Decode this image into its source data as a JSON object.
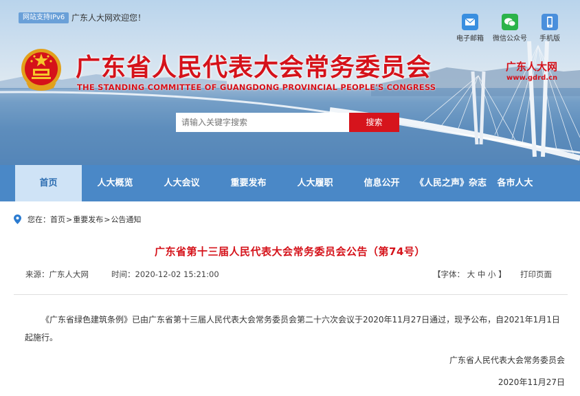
{
  "header": {
    "ipv6_badge": "网站支持IPv6",
    "welcome": "广东人大网欢迎您！",
    "quick_links": [
      {
        "label": "电子邮箱",
        "icon": "mail-icon",
        "color": "#3a8fe0"
      },
      {
        "label": "微信公众号",
        "icon": "wechat-icon",
        "color": "#2bb34a"
      },
      {
        "label": "手机版",
        "icon": "mobile-icon",
        "color": "#4a8fdc"
      }
    ],
    "title": "广东省人民代表大会常务委员会",
    "subtitle": "THE STANDING COMMITTEE OF GUANGDONG PROVINCIAL PEOPLE'S CONGRESS",
    "brand_name": "广东人大网",
    "brand_url": "www.gdrd.cn",
    "search": {
      "placeholder": "请输入关键字搜索",
      "button": "搜索"
    }
  },
  "nav": {
    "items": [
      "首页",
      "人大概览",
      "人大会议",
      "重要发布",
      "人大履职",
      "信息公开",
      "《人民之声》杂志",
      "各市人大"
    ],
    "active_index": 0
  },
  "breadcrumb": {
    "prefix": "您在：",
    "items": [
      "首页",
      "重要发布",
      "公告通知"
    ],
    "separator": ">"
  },
  "article": {
    "title": "广东省第十三届人民代表大会常务委员会公告（第74号）",
    "source": "来源：广东人大网",
    "time": "时间：2020-12-02 15:21:00",
    "font_label": "【字体：",
    "font_sizes": [
      "大",
      "中",
      "小"
    ],
    "font_close": "】",
    "print": "打印页面",
    "body": "《广东省绿色建筑条例》已由广东省第十三届人民代表大会常务委员会第二十六次会议于2020年11月27日通过，现予公布，自2021年1月1日起施行。",
    "signature": "广东省人民代表大会常务委员会",
    "date": "2020年11月27日"
  },
  "colors": {
    "brand_red": "#d5121a",
    "nav_blue": "#4a88c7",
    "nav_active": "#cfe3f6"
  }
}
